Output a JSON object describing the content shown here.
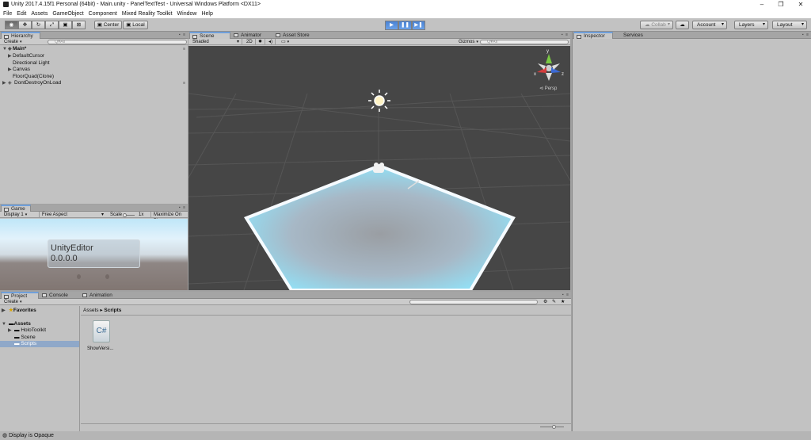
{
  "window": {
    "title": "Unity 2017.4.15f1 Personal (64bit) - Main.unity - PanelTextTest - Universal Windows Platform <DX11>",
    "minimize": "–",
    "maximize": "❐",
    "close": "✕"
  },
  "menu": [
    "File",
    "Edit",
    "Assets",
    "GameObject",
    "Component",
    "Mixed Reality Toolkit",
    "Window",
    "Help"
  ],
  "toolbar": {
    "pivot": "Center",
    "space": "Local",
    "collab": "Collab",
    "account": "Account",
    "layers": "Layers",
    "layout": "Layout"
  },
  "hierarchy": {
    "tab": "Hierarchy",
    "create": "Create",
    "search": "Q▾All",
    "scene": "Main*",
    "items": [
      "DefaultCursor",
      "Directional Light",
      "Canvas",
      "FloorQuad(Clone)"
    ],
    "dontdestroy": "DontDestroyOnLoad"
  },
  "game": {
    "tab": "Game",
    "display": "Display 1",
    "aspect": "Free Aspect",
    "scale_label": "Scale",
    "scale_value": "1x",
    "maximize": "Maximize On Pl",
    "text_line1": "UnityEditor",
    "text_line2": "0.0.0.0"
  },
  "scene": {
    "tabs": [
      "Scene",
      "Animator",
      "Asset Store"
    ],
    "shading": "Shaded",
    "mode2d": "2D",
    "gizmos": "Gizmos",
    "search": "Q▾All",
    "persp": "Persp",
    "axis_y": "y",
    "axis_x": "x",
    "axis_z": "z"
  },
  "inspector": {
    "tabs": [
      "Inspector",
      "Services"
    ]
  },
  "project": {
    "tabs": [
      "Project",
      "Console",
      "Animation"
    ],
    "create": "Create",
    "favorites": "Favorites",
    "assets": "Assets",
    "folders": [
      "HoloToolkit",
      "Scene",
      "Scripts"
    ],
    "breadcrumb": [
      "Assets",
      "Scripts"
    ],
    "file_label": "ShowVersi...",
    "file_icon": "C#"
  },
  "status": {
    "text": "Display is Opaque"
  },
  "colors": {
    "accent": "#6f9fda",
    "play_blue": "#4a83d4",
    "scene_bg": "#464646",
    "floor_glow": "#8ee8ff",
    "selection": "#8fa8c9"
  }
}
